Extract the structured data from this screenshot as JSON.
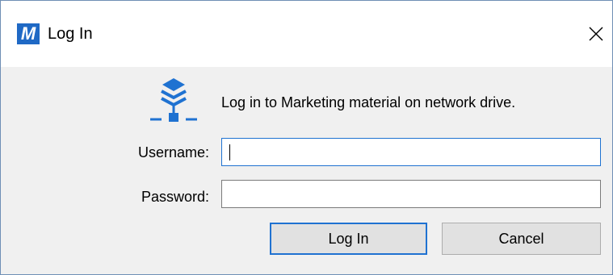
{
  "window": {
    "app_icon_letter": "M",
    "title": "Log In",
    "close_glyph": "✕"
  },
  "dialog": {
    "message": "Log in to Marketing material on network drive.",
    "icon": "network-drive-icon",
    "username": {
      "label": "Username:",
      "value": ""
    },
    "password": {
      "label": "Password:",
      "value": ""
    },
    "login_label": "Log In",
    "cancel_label": "Cancel"
  },
  "colors": {
    "accent": "#1f72d1",
    "app_icon_bg": "#1f69c5",
    "dialog_bg": "#f0f0f0",
    "button_bg": "#e1e1e1"
  }
}
